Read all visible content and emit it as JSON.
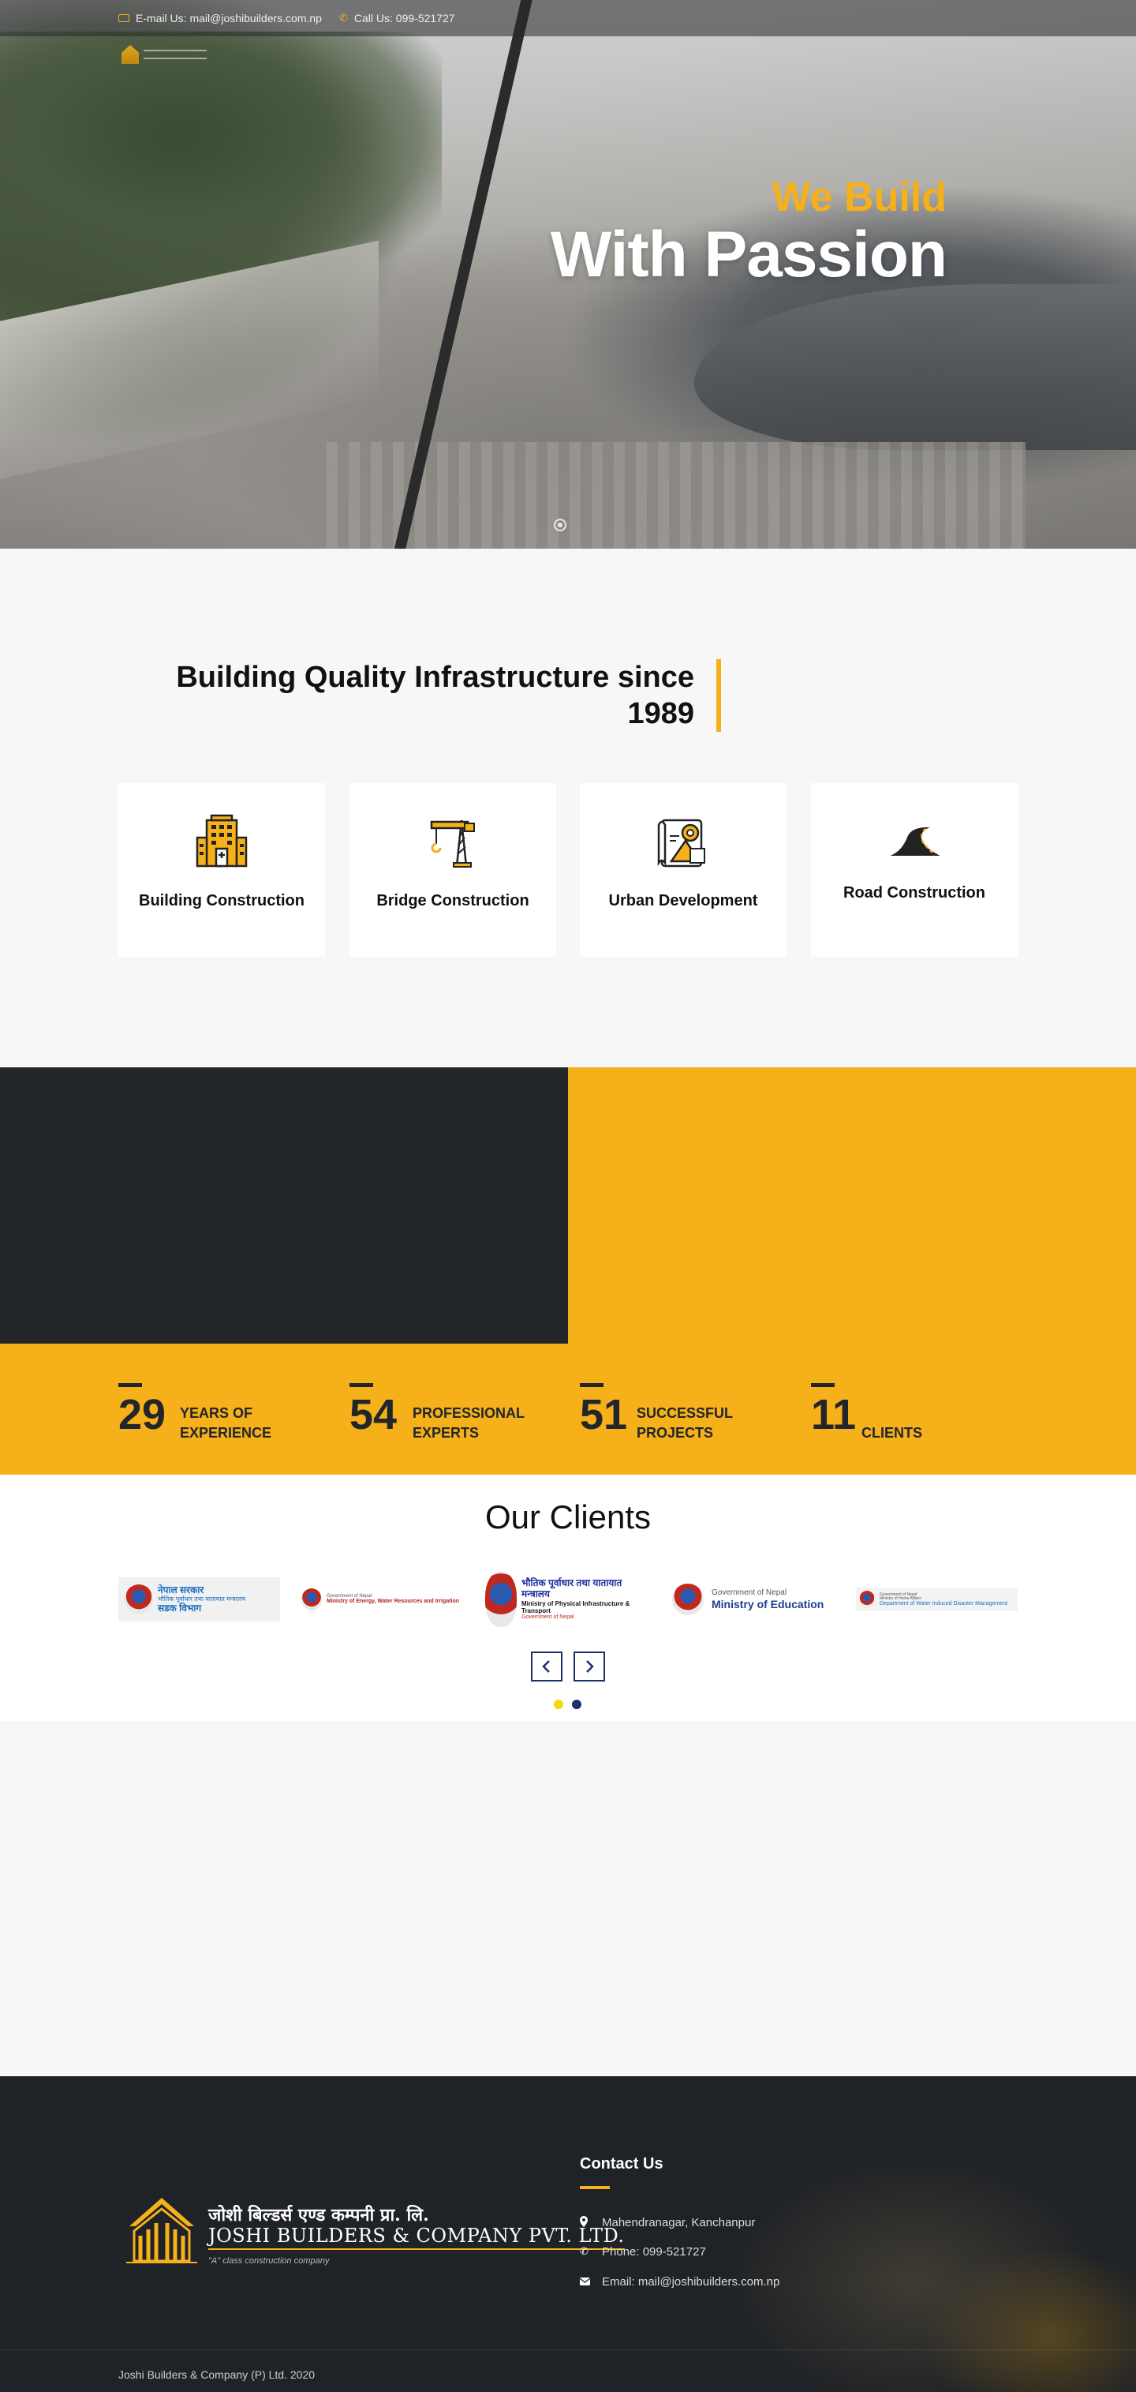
{
  "topbar": {
    "email": "E-mail Us: mail@joshibuilders.com.np",
    "phone": "Call Us: 099-521727"
  },
  "hero": {
    "line1": "We Build",
    "line2": "With Passion"
  },
  "services": {
    "tagline_1": "Building Quality Infrastructure since",
    "tagline_2": "1989",
    "cards": [
      {
        "label": "Building Construction",
        "icon": "building-icon"
      },
      {
        "label": "Bridge Construction",
        "icon": "crane-icon"
      },
      {
        "label": "Urban Development",
        "icon": "blueprint-icon"
      },
      {
        "label": "Road Construction",
        "icon": "road-icon"
      }
    ]
  },
  "stats": [
    {
      "number": "29",
      "label": "YEARS OF EXPERIENCE"
    },
    {
      "number": "54",
      "label": "PROFESSIONAL EXPERTS"
    },
    {
      "number": "51",
      "label": "SUCCESSFUL PROJECTS"
    },
    {
      "number": "11",
      "label": "CLIENTS"
    }
  ],
  "clients": {
    "title": "Our Clients",
    "logos": [
      {
        "line1": "नेपाल सरकार",
        "line2": "भौतिक पूर्वाधार तथा यातायात मन्त्रालय",
        "line3": "सडक विभाग"
      },
      {
        "line1": "Government of Nepal",
        "line2": "Ministry of Energy, Water Resources and Irrigation"
      },
      {
        "line1": "भौतिक पूर्वाधार तथा यातायात मन्त्रालय",
        "line2": "Ministry of Physical Infrastructure & Transport",
        "line3": "Government of Nepal"
      },
      {
        "line1": "Government of Nepal",
        "line2": "Ministry of Education"
      },
      {
        "line1": "Government of Nepal",
        "line2": "Ministry of Home Affairs",
        "line3": "Department of Water Induced Disaster Management"
      }
    ],
    "prev_label": "‹",
    "next_label": "›",
    "dot_active_color": "#f5d90a",
    "dot_color": "#1d2f6f"
  },
  "footer": {
    "logo_np": "जोशी बिल्डर्स एण्ड कम्पनी प्रा. लि.",
    "logo_en": "JOSHI BUILDERS & COMPANY PVT. LTD.",
    "logo_sub": "\"A\" class construction company",
    "contact_title": "Contact Us",
    "address": "Mahendranagar, Kanchanpur",
    "phone": "Phone: 099-521727",
    "email": "Email: mail@joshibuilders.com.np",
    "copyright": "Joshi Builders & Company (P) Ltd. 2020"
  },
  "colors": {
    "accent": "#f5b01a",
    "dark": "#22262a",
    "nav": "#1d2f6f"
  }
}
